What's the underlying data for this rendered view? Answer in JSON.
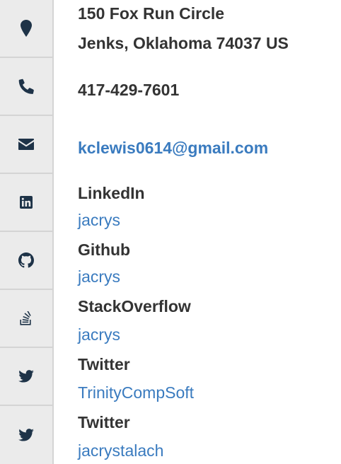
{
  "address": {
    "line1": "150 Fox Run Circle",
    "line2": "Jenks, Oklahoma 74037 US",
    "icon": "map-marker-icon"
  },
  "phone": {
    "value": "417-429-7601",
    "icon": "phone-icon"
  },
  "email": {
    "value": "kclewis0614@gmail.com",
    "icon": "envelope-icon"
  },
  "profiles": [
    {
      "network": "LinkedIn",
      "username": "jacrys",
      "icon": "linkedin-icon"
    },
    {
      "network": "Github",
      "username": "jacrys",
      "icon": "github-icon"
    },
    {
      "network": "StackOverflow",
      "username": "jacrys",
      "icon": "stackoverflow-icon"
    },
    {
      "network": "Twitter",
      "username": "TrinityCompSoft",
      "icon": "twitter-icon"
    },
    {
      "network": "Twitter",
      "username": "jacrystalach",
      "icon": "twitter-icon"
    }
  ],
  "colors": {
    "icon": "#1e3348",
    "link": "#3a7bbf",
    "text": "#333333",
    "sidebar": "#ebebeb"
  }
}
